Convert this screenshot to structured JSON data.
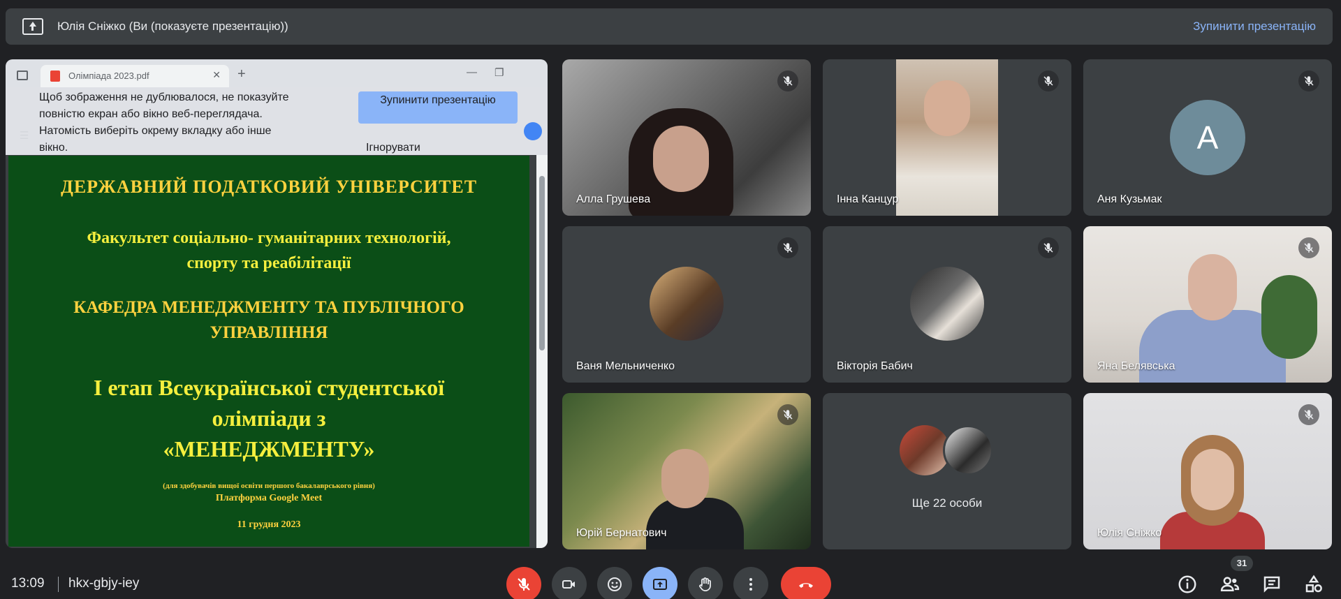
{
  "topbar": {
    "title": "Юлія Сніжко (Ви (показуєте презентацію))",
    "stop_label": "Зупинити презентацію"
  },
  "share_notice": {
    "message": "Щоб зображення не дублювалося, не показуйте повністю екран або вікно веб-переглядача. Натомість виберіть окрему вкладку або інше вікно.",
    "stop_button": "Зупинити презентацію",
    "ignore": "Ігнорувати"
  },
  "browser": {
    "tab_title": "Олімпіада 2023.pdf"
  },
  "slide": {
    "line1": "ДЕРЖАВНИЙ ПОДАТКОВИЙ УНІВЕРСИТЕТ",
    "line2a": "Факультет соціально- гуманітарних технологій,",
    "line2b": "спорту та реабілітації",
    "line3a": "КАФЕДРА МЕНЕДЖМЕНТУ ТА ПУБЛІЧНОГО",
    "line3b": "УПРАВЛІННЯ",
    "line4a": "І етап Всеукраїнської студентської",
    "line4b": "олімпіади з",
    "line4c": "«МЕНЕДЖМЕНТУ»",
    "line5": "(для здобувачів вищої освіти першого бакалаврського рівня)",
    "line6": "Платформа Google Meet",
    "line7": "11 грудня 2023"
  },
  "participants": [
    {
      "name": "Алла Грушева"
    },
    {
      "name": "Інна Канцур"
    },
    {
      "name": "Аня Кузьмак",
      "avatar_letter": "А"
    },
    {
      "name": "Ваня Мельниченко"
    },
    {
      "name": "Вікторія Бабич"
    },
    {
      "name": "Яна Белявська"
    },
    {
      "name": "Юрій Бернатович"
    },
    {
      "more_label": "Ще 22 особи"
    },
    {
      "name": "Юлія Сніжко"
    }
  ],
  "bottom": {
    "time": "13:09",
    "meeting_code": "hkx-gbjy-iey",
    "participants_count": "31"
  },
  "colors": {
    "background": "#202124",
    "surface": "#3c4043",
    "accent": "#8ab4f8",
    "danger": "#ea4335",
    "slide_bg": "#0b4e17",
    "slide_text": "#ffd23f"
  }
}
